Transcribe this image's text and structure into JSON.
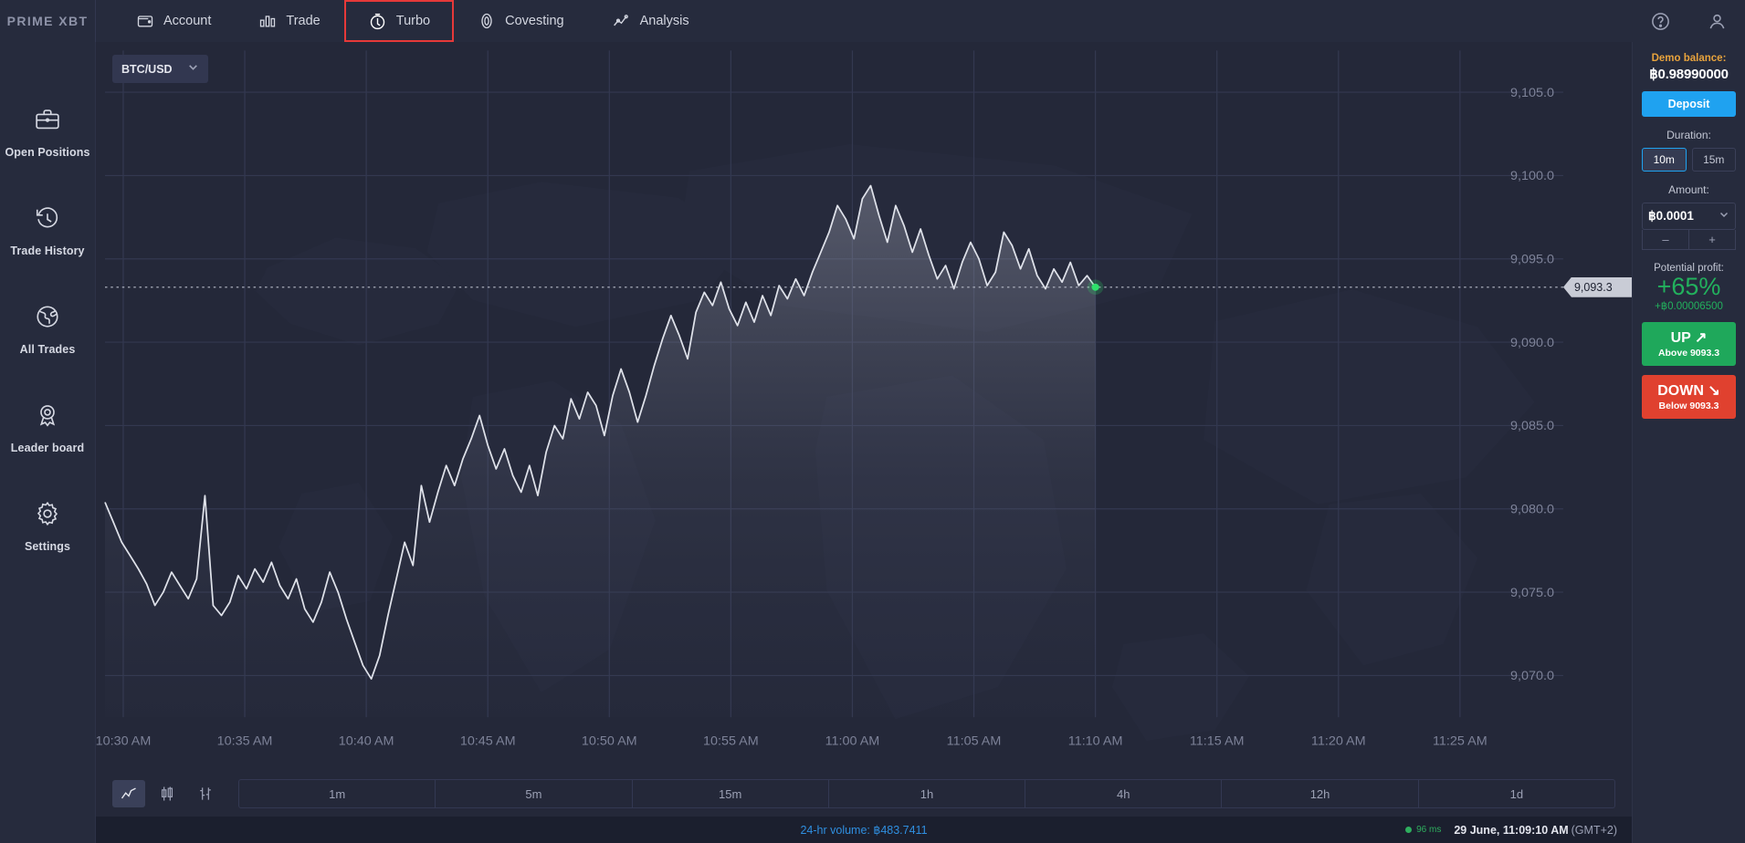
{
  "brand": {
    "text": "PRIME XBT"
  },
  "topnav": {
    "items": [
      {
        "label": "Account",
        "icon": "wallet-icon",
        "active": false
      },
      {
        "label": "Trade",
        "icon": "bars-icon",
        "active": false
      },
      {
        "label": "Turbo",
        "icon": "turbo-icon",
        "active": true
      },
      {
        "label": "Covesting",
        "icon": "coin-icon",
        "active": false
      },
      {
        "label": "Analysis",
        "icon": "analysis-icon",
        "active": false
      }
    ],
    "help_icon": "help-circle-icon",
    "profile_icon": "user-icon"
  },
  "sidebar": {
    "items": [
      {
        "label": "Open Positions",
        "icon": "briefcase-icon"
      },
      {
        "label": "Trade History",
        "icon": "history-clock-icon"
      },
      {
        "label": "All Trades",
        "icon": "globe-icon"
      },
      {
        "label": "Leader board",
        "icon": "award-icon"
      },
      {
        "label": "Settings",
        "icon": "gear-icon"
      }
    ]
  },
  "chart_panel": {
    "symbol": "BTC/USD",
    "symbol_caret_icon": "chevron-down-icon",
    "price_tag": "9,093.3"
  },
  "chart_data": {
    "type": "area",
    "title": "BTC/USD",
    "xlabel": "",
    "ylabel": "",
    "ylim": [
      9067.5,
      9107.5
    ],
    "yticks": [
      9105.0,
      9100.0,
      9095.0,
      9090.0,
      9085.0,
      9080.0,
      9075.0,
      9070.0
    ],
    "ytick_labels": [
      "9,105.0",
      "9,100.0",
      "9,095.0",
      "9,090.0",
      "9,085.0",
      "9,080.0",
      "9,075.0",
      "9,070.0"
    ],
    "xticks": [
      "10:30 AM",
      "10:35 AM",
      "10:40 AM",
      "10:45 AM",
      "10:50 AM",
      "10:55 AM",
      "11:00 AM",
      "11:05 AM",
      "11:10 AM",
      "11:15 AM",
      "11:20 AM",
      "11:25 AM"
    ],
    "grid": true,
    "legend": "none",
    "current_price": 9093.3,
    "current_price_label": "9,093.3",
    "last_point_time": "11:09:10 AM",
    "series": [
      {
        "name": "BTC/USD",
        "color": "#dfe2ea",
        "x": [
          0,
          1,
          2,
          3,
          4,
          5,
          6,
          7,
          8,
          9,
          10,
          11,
          12,
          13,
          14,
          15,
          16,
          17,
          18,
          19,
          20,
          21,
          22,
          23,
          24,
          25,
          26,
          27,
          28,
          29,
          30,
          31,
          32,
          33,
          34,
          35,
          36,
          37,
          38,
          39,
          40,
          41,
          42,
          43,
          44,
          45,
          46,
          47,
          48,
          49,
          50,
          51,
          52,
          53,
          54,
          55,
          56,
          57,
          58,
          59,
          60,
          61,
          62,
          63,
          64,
          65,
          66,
          67,
          68,
          69,
          70,
          71,
          72,
          73,
          74,
          75,
          76,
          77,
          78,
          79,
          80,
          81,
          82,
          83,
          84,
          85,
          86,
          87,
          88,
          89,
          90,
          91,
          92,
          93,
          94,
          95,
          96,
          97,
          98,
          99,
          100,
          101,
          102,
          103,
          104,
          105,
          106,
          107,
          108,
          109,
          110,
          111,
          112,
          113,
          114,
          115,
          116,
          117,
          118,
          119
        ],
        "values": [
          9080.4,
          9079.2,
          9078.0,
          9077.2,
          9076.4,
          9075.5,
          9074.2,
          9075.0,
          9076.2,
          9075.4,
          9074.6,
          9075.8,
          9080.8,
          9074.2,
          9073.6,
          9074.4,
          9076.0,
          9075.2,
          9076.4,
          9075.6,
          9076.8,
          9075.4,
          9074.6,
          9075.8,
          9074.0,
          9073.2,
          9074.4,
          9076.2,
          9075.0,
          9073.4,
          9072.0,
          9070.6,
          9069.8,
          9071.2,
          9073.6,
          9075.8,
          9078.0,
          9076.6,
          9081.4,
          9079.2,
          9081.0,
          9082.6,
          9081.4,
          9083.0,
          9084.2,
          9085.6,
          9083.8,
          9082.4,
          9083.6,
          9082.0,
          9081.0,
          9082.6,
          9080.8,
          9083.4,
          9085.0,
          9084.2,
          9086.6,
          9085.4,
          9087.0,
          9086.2,
          9084.4,
          9086.8,
          9088.4,
          9087.0,
          9085.2,
          9086.8,
          9088.6,
          9090.2,
          9091.6,
          9090.4,
          9089.0,
          9091.8,
          9093.0,
          9092.2,
          9093.6,
          9092.0,
          9091.0,
          9092.4,
          9091.2,
          9092.8,
          9091.6,
          9093.4,
          9092.6,
          9093.8,
          9092.8,
          9094.2,
          9095.4,
          9096.6,
          9098.2,
          9097.4,
          9096.2,
          9098.6,
          9099.4,
          9097.6,
          9096.0,
          9098.2,
          9097.0,
          9095.4,
          9096.8,
          9095.2,
          9093.8,
          9094.6,
          9093.2,
          9094.8,
          9096.0,
          9095.0,
          9093.4,
          9094.2,
          9096.6,
          9095.8,
          9094.4,
          9095.6,
          9094.0,
          9093.2,
          9094.4,
          9093.6,
          9094.8,
          9093.4,
          9094.0,
          9093.3
        ]
      }
    ]
  },
  "timeframe_bar": {
    "chart_types": [
      {
        "name": "line-chart-icon",
        "active": true
      },
      {
        "name": "candlestick-chart-icon",
        "active": false
      },
      {
        "name": "bar-chart-icon",
        "active": false
      }
    ],
    "timeframes": [
      {
        "label": "1m",
        "active": false
      },
      {
        "label": "5m",
        "active": false
      },
      {
        "label": "15m",
        "active": false
      },
      {
        "label": "1h",
        "active": false
      },
      {
        "label": "4h",
        "active": false
      },
      {
        "label": "12h",
        "active": false
      },
      {
        "label": "1d",
        "active": false
      }
    ]
  },
  "status_bar": {
    "volume": "24-hr volume: ฿483.7411",
    "ping": "96 ms",
    "time": "29 June, 11:09:10 AM",
    "timezone": "(GMT+2)"
  },
  "right_panel": {
    "balance_label": "Demo balance:",
    "balance_value": "฿0.98990000",
    "deposit_label": "Deposit",
    "duration_label": "Duration:",
    "durations": [
      {
        "label": "10m",
        "active": true
      },
      {
        "label": "15m",
        "active": false
      }
    ],
    "amount_label": "Amount:",
    "amount_value": "฿0.0001",
    "amount_caret_icon": "chevron-down-icon",
    "decrement_label": "–",
    "increment_label": "+",
    "profit_label": "Potential profit:",
    "profit_percent": "+65%",
    "profit_absolute": "+฿0.00006500",
    "up_label": "UP",
    "up_sub": "Above 9093.3",
    "down_label": "DOWN",
    "down_sub": "Below 9093.3"
  },
  "colors": {
    "accent_blue": "#1fa2f0",
    "up_green": "#1fa85b",
    "down_red": "#e0412f",
    "balance_gold": "#e8a33d",
    "active_tab_outline": "#e63939"
  }
}
